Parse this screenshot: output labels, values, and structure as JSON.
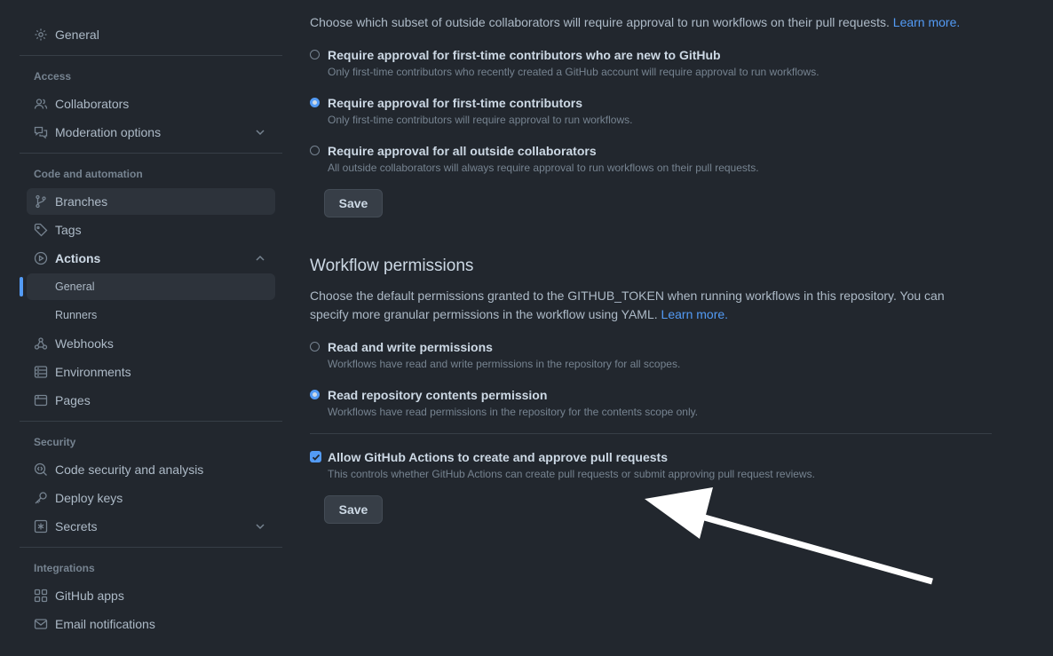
{
  "sidebar": {
    "general": "General",
    "sections": {
      "access": "Access",
      "code_automation": "Code and automation",
      "security": "Security",
      "integrations": "Integrations"
    },
    "items": {
      "collaborators": "Collaborators",
      "moderation": "Moderation options",
      "branches": "Branches",
      "tags": "Tags",
      "actions": "Actions",
      "actions_general": "General",
      "actions_runners": "Runners",
      "webhooks": "Webhooks",
      "environments": "Environments",
      "pages": "Pages",
      "code_security": "Code security and analysis",
      "deploy_keys": "Deploy keys",
      "secrets": "Secrets",
      "github_apps": "GitHub apps",
      "email_notifications": "Email notifications"
    }
  },
  "fork_approval": {
    "description": "Choose which subset of outside collaborators will require approval to run workflows on their pull requests.",
    "learn_more": "Learn more.",
    "options": [
      {
        "label": "Require approval for first-time contributors who are new to GitHub",
        "note": "Only first-time contributors who recently created a GitHub account will require approval to run workflows.",
        "checked": false
      },
      {
        "label": "Require approval for first-time contributors",
        "note": "Only first-time contributors will require approval to run workflows.",
        "checked": true
      },
      {
        "label": "Require approval for all outside collaborators",
        "note": "All outside collaborators will always require approval to run workflows on their pull requests.",
        "checked": false
      }
    ],
    "save": "Save"
  },
  "workflow_permissions": {
    "title": "Workflow permissions",
    "description_1": "Choose the default permissions granted to the GITHUB_TOKEN when running workflows in this repository. You can",
    "description_2": "specify more granular permissions in the workflow using YAML.",
    "learn_more": "Learn more.",
    "options": [
      {
        "label": "Read and write permissions",
        "note": "Workflows have read and write permissions in the repository for all scopes.",
        "checked": false
      },
      {
        "label": "Read repository contents permission",
        "note": "Workflows have read permissions in the repository for the contents scope only.",
        "checked": true
      }
    ],
    "allow_pr": {
      "label": "Allow GitHub Actions to create and approve pull requests",
      "note": "This controls whether GitHub Actions can create pull requests or submit approving pull request reviews.",
      "checked": true
    },
    "save": "Save"
  },
  "colors": {
    "background": "#22272e",
    "accent": "#539bf5",
    "text": "#adbac7",
    "muted": "#768390",
    "annotation_arrow": "#ffffff"
  }
}
